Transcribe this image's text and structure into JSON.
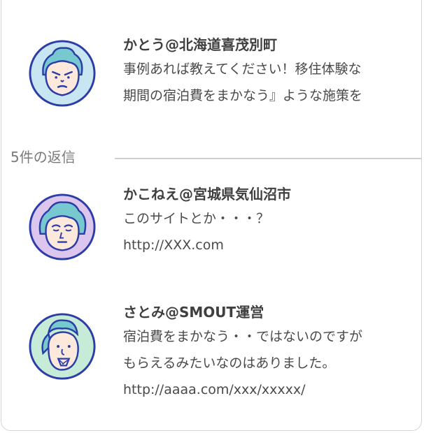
{
  "comments": [
    {
      "name": "かとう@北海道喜茂別町",
      "lines": [
        "事例あれば教えてください！移住体験な",
        "期間の宿泊費をまかなう』ような施策を"
      ],
      "avatar_icon": "man-avatar-icon",
      "avatar_ring": "#c8e6f2"
    },
    {
      "name": "かこねえ@宮城県気仙沼市",
      "lines": [
        "このサイトとか・・・？",
        "http://XXX.com"
      ],
      "avatar_icon": "woman-avatar-icon",
      "avatar_ring": "#dcc6ee"
    },
    {
      "name": "さとみ@SMOUT運営",
      "lines": [
        "宿泊費をまかなう・・ではないのですが",
        "もらえるみたいなのはありました。",
        "http://aaaa.com/xxx/xxxxx/"
      ],
      "avatar_icon": "woman-avatar-icon",
      "avatar_ring": "#c6ecd8"
    }
  ],
  "replies": {
    "label": "5件の返信"
  },
  "colors": {
    "outline": "#2c3da8",
    "face": "#fde9dc",
    "hair_teal": "#77c8cf",
    "border": "#d4d4d4"
  }
}
